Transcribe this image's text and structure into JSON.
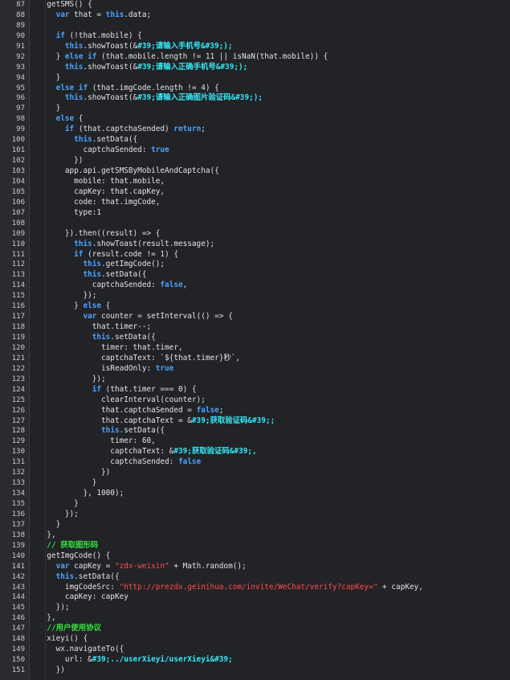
{
  "editor": {
    "language": "javascript",
    "colors": {
      "background": "#222327",
      "keyword": "#4aa3ff",
      "string": "#ff4b4b",
      "comment": "#37e03f",
      "highlighted_literal": "#35e9f7",
      "text": "#e4e4e4",
      "line_number": "#c9c9c9"
    },
    "lines": [
      {
        "n": "87",
        "tokens": [
          [
            "p",
            "  getSMS() {"
          ]
        ]
      },
      {
        "n": "88",
        "tokens": [
          [
            "p",
            "    "
          ],
          [
            "k",
            "var"
          ],
          [
            "p",
            " that = "
          ],
          [
            "k",
            "this"
          ],
          [
            "p",
            ".data;"
          ]
        ]
      },
      {
        "n": "89",
        "tokens": []
      },
      {
        "n": "90",
        "tokens": [
          [
            "p",
            "    "
          ],
          [
            "k",
            "if"
          ],
          [
            "p",
            " (!that.mobile) {"
          ]
        ]
      },
      {
        "n": "91",
        "tokens": [
          [
            "p",
            "      "
          ],
          [
            "k",
            "this"
          ],
          [
            "p",
            ".showToast(&"
          ],
          [
            "c",
            "#39;请输入手机号&#39;);"
          ]
        ]
      },
      {
        "n": "92",
        "tokens": [
          [
            "p",
            "    } "
          ],
          [
            "k",
            "else if"
          ],
          [
            "p",
            " (that.mobile.length != 11 || isNaN(that.mobile)) {"
          ]
        ]
      },
      {
        "n": "93",
        "tokens": [
          [
            "p",
            "      "
          ],
          [
            "k",
            "this"
          ],
          [
            "p",
            ".showToast(&"
          ],
          [
            "c",
            "#39;请输入正确手机号&#39;);"
          ]
        ]
      },
      {
        "n": "94",
        "tokens": [
          [
            "p",
            "    }"
          ]
        ]
      },
      {
        "n": "95",
        "tokens": [
          [
            "p",
            "    "
          ],
          [
            "k",
            "else if"
          ],
          [
            "p",
            " (that.imgCode.length != 4) {"
          ]
        ]
      },
      {
        "n": "96",
        "tokens": [
          [
            "p",
            "      "
          ],
          [
            "k",
            "this"
          ],
          [
            "p",
            ".showToast(&"
          ],
          [
            "c",
            "#39;请输入正确图片验证码&#39;);"
          ]
        ]
      },
      {
        "n": "97",
        "tokens": [
          [
            "p",
            "    }"
          ]
        ]
      },
      {
        "n": "98",
        "tokens": [
          [
            "p",
            "    "
          ],
          [
            "k",
            "else"
          ],
          [
            "p",
            " {"
          ]
        ]
      },
      {
        "n": "99",
        "tokens": [
          [
            "p",
            "      "
          ],
          [
            "k",
            "if"
          ],
          [
            "p",
            " (that.captchaSended) "
          ],
          [
            "k",
            "return"
          ],
          [
            "p",
            ";"
          ]
        ]
      },
      {
        "n": "100",
        "tokens": [
          [
            "p",
            "        "
          ],
          [
            "k",
            "this"
          ],
          [
            "p",
            ".setData({"
          ]
        ]
      },
      {
        "n": "101",
        "tokens": [
          [
            "p",
            "          captchaSended: "
          ],
          [
            "k",
            "true"
          ]
        ]
      },
      {
        "n": "102",
        "tokens": [
          [
            "p",
            "        })"
          ]
        ]
      },
      {
        "n": "103",
        "tokens": [
          [
            "p",
            "      app.api.getSMSByMobileAndCaptcha({"
          ]
        ]
      },
      {
        "n": "104",
        "tokens": [
          [
            "p",
            "        mobile: that.mobile,"
          ]
        ]
      },
      {
        "n": "105",
        "tokens": [
          [
            "p",
            "        capKey: that.capKey,"
          ]
        ]
      },
      {
        "n": "106",
        "tokens": [
          [
            "p",
            "        code: that.imgCode,"
          ]
        ]
      },
      {
        "n": "107",
        "tokens": [
          [
            "p",
            "        type:1"
          ]
        ]
      },
      {
        "n": "108",
        "tokens": []
      },
      {
        "n": "109",
        "tokens": [
          [
            "p",
            "      }).then((result) => {"
          ]
        ]
      },
      {
        "n": "110",
        "tokens": [
          [
            "p",
            "        "
          ],
          [
            "k",
            "this"
          ],
          [
            "p",
            ".showToast(result.message);"
          ]
        ]
      },
      {
        "n": "111",
        "tokens": [
          [
            "p",
            "        "
          ],
          [
            "k",
            "if"
          ],
          [
            "p",
            " (result.code != 1) {"
          ]
        ]
      },
      {
        "n": "112",
        "tokens": [
          [
            "p",
            "          "
          ],
          [
            "k",
            "this"
          ],
          [
            "p",
            ".getImgCode();"
          ]
        ]
      },
      {
        "n": "113",
        "tokens": [
          [
            "p",
            "          "
          ],
          [
            "k",
            "this"
          ],
          [
            "p",
            ".setData({"
          ]
        ]
      },
      {
        "n": "114",
        "tokens": [
          [
            "p",
            "            captchaSended: "
          ],
          [
            "k",
            "false"
          ],
          [
            "p",
            ","
          ]
        ]
      },
      {
        "n": "115",
        "tokens": [
          [
            "p",
            "          });"
          ]
        ]
      },
      {
        "n": "116",
        "tokens": [
          [
            "p",
            "        } "
          ],
          [
            "k",
            "else"
          ],
          [
            "p",
            " {"
          ]
        ]
      },
      {
        "n": "117",
        "tokens": [
          [
            "p",
            "          "
          ],
          [
            "k",
            "var"
          ],
          [
            "p",
            " counter = setInterval(() => {"
          ]
        ]
      },
      {
        "n": "118",
        "tokens": [
          [
            "p",
            "            that.timer--;"
          ]
        ]
      },
      {
        "n": "119",
        "tokens": [
          [
            "p",
            "            "
          ],
          [
            "k",
            "this"
          ],
          [
            "p",
            ".setData({"
          ]
        ]
      },
      {
        "n": "120",
        "tokens": [
          [
            "p",
            "              timer: that.timer,"
          ]
        ]
      },
      {
        "n": "121",
        "tokens": [
          [
            "p",
            "              captchaText: `${that.timer}秒`,"
          ]
        ]
      },
      {
        "n": "122",
        "tokens": [
          [
            "p",
            "              isReadOnly: "
          ],
          [
            "k",
            "true"
          ]
        ]
      },
      {
        "n": "123",
        "tokens": [
          [
            "p",
            "            });"
          ]
        ]
      },
      {
        "n": "124",
        "tokens": [
          [
            "p",
            "            "
          ],
          [
            "k",
            "if"
          ],
          [
            "p",
            " (that.timer === 0) {"
          ]
        ]
      },
      {
        "n": "125",
        "tokens": [
          [
            "p",
            "              clearInterval(counter);"
          ]
        ]
      },
      {
        "n": "126",
        "tokens": [
          [
            "p",
            "              that.captchaSended = "
          ],
          [
            "k",
            "false"
          ],
          [
            "p",
            ";"
          ]
        ]
      },
      {
        "n": "127",
        "tokens": [
          [
            "p",
            "              that.captchaText = &"
          ],
          [
            "c",
            "#39;获取验证码&#39;;"
          ]
        ]
      },
      {
        "n": "128",
        "tokens": [
          [
            "p",
            "              "
          ],
          [
            "k",
            "this"
          ],
          [
            "p",
            ".setData({"
          ]
        ]
      },
      {
        "n": "129",
        "tokens": [
          [
            "p",
            "                timer: 60,"
          ]
        ]
      },
      {
        "n": "130",
        "tokens": [
          [
            "p",
            "                captchaText: &"
          ],
          [
            "c",
            "#39;获取验证码&#39;,"
          ]
        ]
      },
      {
        "n": "131",
        "tokens": [
          [
            "p",
            "                captchaSended: "
          ],
          [
            "k",
            "false"
          ]
        ]
      },
      {
        "n": "132",
        "tokens": [
          [
            "p",
            "              })"
          ]
        ]
      },
      {
        "n": "133",
        "tokens": [
          [
            "p",
            "            }"
          ]
        ]
      },
      {
        "n": "134",
        "tokens": [
          [
            "p",
            "          }, 1000);"
          ]
        ]
      },
      {
        "n": "135",
        "tokens": [
          [
            "p",
            "        }"
          ]
        ]
      },
      {
        "n": "136",
        "tokens": [
          [
            "p",
            "      });"
          ]
        ]
      },
      {
        "n": "137",
        "tokens": [
          [
            "p",
            "    }"
          ]
        ]
      },
      {
        "n": "138",
        "tokens": [
          [
            "p",
            "  },"
          ]
        ]
      },
      {
        "n": "139",
        "tokens": [
          [
            "p",
            "  "
          ],
          [
            "g",
            "// 获取图形码"
          ]
        ]
      },
      {
        "n": "140",
        "tokens": [
          [
            "p",
            "  getImgCode() {"
          ]
        ]
      },
      {
        "n": "141",
        "tokens": [
          [
            "p",
            "    "
          ],
          [
            "k",
            "var"
          ],
          [
            "p",
            " capKey = "
          ],
          [
            "s",
            "\"zdx-weixin\""
          ],
          [
            "p",
            " + Math.random();"
          ]
        ]
      },
      {
        "n": "142",
        "tokens": [
          [
            "p",
            "    "
          ],
          [
            "k",
            "this"
          ],
          [
            "p",
            ".setData({"
          ]
        ]
      },
      {
        "n": "143",
        "tokens": [
          [
            "p",
            "      imgCodeSrc: "
          ],
          [
            "s",
            "\"http://prezdx.geinihua.com/invite/WeChat/verify?capKey=\""
          ],
          [
            "p",
            " + capKey,"
          ]
        ]
      },
      {
        "n": "144",
        "tokens": [
          [
            "p",
            "      capKey: capKey"
          ]
        ]
      },
      {
        "n": "145",
        "tokens": [
          [
            "p",
            "    });"
          ]
        ]
      },
      {
        "n": "146",
        "tokens": [
          [
            "p",
            "  },"
          ]
        ]
      },
      {
        "n": "147",
        "tokens": [
          [
            "p",
            "  "
          ],
          [
            "g",
            "//用户使用协议"
          ]
        ]
      },
      {
        "n": "148",
        "tokens": [
          [
            "p",
            "  xieyi() {"
          ]
        ]
      },
      {
        "n": "149",
        "tokens": [
          [
            "p",
            "    wx.navigateTo({"
          ]
        ]
      },
      {
        "n": "150",
        "tokens": [
          [
            "p",
            "      url: &"
          ],
          [
            "c",
            "#39;../userXieyi/userXieyi&#39;"
          ]
        ]
      },
      {
        "n": "151",
        "tokens": [
          [
            "p",
            "    })"
          ]
        ]
      }
    ]
  }
}
